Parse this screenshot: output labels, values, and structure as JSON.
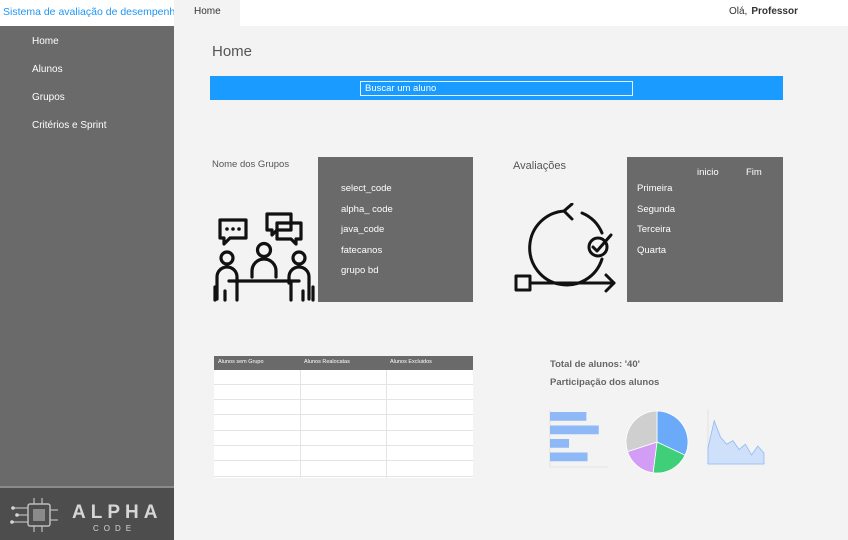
{
  "app": {
    "title": "Sistema de avaliação de desempenho"
  },
  "topbar": {
    "active_tab": "Home",
    "greeting": "Olá,",
    "user": "Professor"
  },
  "sidebar": {
    "items": [
      {
        "label": "Home"
      },
      {
        "label": "Alunos"
      },
      {
        "label": "Grupos"
      },
      {
        "label": "Critérios e Sprint"
      }
    ],
    "logo": {
      "name": "ALPHA",
      "sub": "CODE"
    }
  },
  "main": {
    "title": "Home",
    "search": {
      "placeholder": "Buscar um aluno"
    },
    "groups": {
      "label": "Nome dos Grupos",
      "icon": "team-meeting-icon",
      "items": [
        "select_code",
        "alpha_ code",
        "java_code",
        "fatecanos",
        "grupo bd"
      ]
    },
    "evaluations": {
      "label": "Avaliações",
      "icon": "cycle-process-icon",
      "col_start": "inicio",
      "col_end": "Fim",
      "rows": [
        "Primeira",
        "Segunda",
        "Terceira",
        "Quarta"
      ]
    },
    "table": {
      "headers": [
        "Alunos sem Grupo",
        "Alunos Realocatas",
        "Alunos Excluidos"
      ],
      "rows": 7
    },
    "stats": {
      "total": "Total de alunos: '40'",
      "participation": "Participação dos alunos"
    }
  },
  "colors": {
    "accent": "#1a9bff",
    "sidebar": "#6a6a6a",
    "panel": "#6a6a6a",
    "chart_blue": "#8fb8f7",
    "pie_blue": "#6aaaf8",
    "pie_green": "#3ecf78",
    "pie_purple": "#d39cf5",
    "pie_gray": "#cfcfcf"
  },
  "chart_data": [
    {
      "type": "bar",
      "orientation": "horizontal",
      "categories": [
        "",
        "",
        "",
        ""
      ],
      "values": [
        0.65,
        0.87,
        0.34,
        0.67
      ],
      "title": "",
      "xlabel": "",
      "ylabel": ""
    },
    {
      "type": "pie",
      "labels": [
        "",
        "",
        "",
        ""
      ],
      "values": [
        0.32,
        0.2,
        0.18,
        0.3
      ],
      "colors": [
        "#6aaaf8",
        "#3ecf78",
        "#d39cf5",
        "#cfcfcf"
      ]
    },
    {
      "type": "area",
      "x": [
        0,
        1,
        2,
        3,
        4,
        5,
        6,
        7,
        8,
        9
      ],
      "values": [
        18,
        48,
        30,
        22,
        26,
        16,
        22,
        10,
        20,
        12
      ],
      "ylim": [
        0,
        60
      ]
    }
  ]
}
